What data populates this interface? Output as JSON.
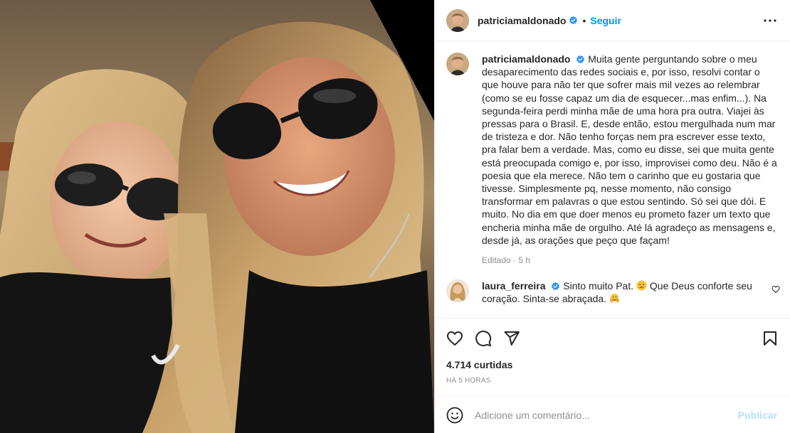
{
  "post": {
    "author": "patriciamaldonado",
    "follow_label": "Seguir",
    "dot": "•",
    "caption_text": "Muita gente perguntando sobre o meu desaparecimento das redes sociais e, por isso, resolvi contar o que houve para não ter que sofrer mais mil vezes ao relembrar (como se eu fosse capaz um dia de esquecer...mas enfim...). Na segunda-feira perdi minha mãe de uma hora pra outra. Viajei às pressas para o Brasil. E, desde então, estou mergulhada num mar de tristeza e dor. Não tenho forças nem pra escrever esse texto, pra falar bem a verdade. Mas, como eu disse, sei que muita gente está preocupada comigo e, por isso, improvisei como deu. Não é a poesia que ela merece. Não tem o carinho que eu gostaria que tivesse. Simplesmente pq, nesse momento, não consigo transformar em palavras o que estou sentindo. Só sei que dói. E muito. No dia em que doer menos eu prometo fazer um texto que encheria minha mãe de orgulho. Até lá agradeço as mensagens e, desde já, as orações que peço que façam!",
    "caption_meta": "Editado · 5 h",
    "likes": "4.714 curtidas",
    "timestamp": "HÁ 5 HORAS"
  },
  "comments": [
    {
      "user": "laura_ferreira",
      "text_part1": "Sinto muito Pat. ",
      "text_part2": "Que Deus conforte seu coração. Sinta-se abraçada. "
    }
  ],
  "composer": {
    "placeholder": "Adicione um comentário...",
    "publish_label": "Publicar"
  },
  "icons": {
    "verified": "verified-badge-icon",
    "more": "more-options-icon",
    "like": "heart-icon",
    "comment": "comment-icon",
    "share": "send-icon",
    "save": "bookmark-icon",
    "emoji": "smile-icon"
  },
  "colors": {
    "accent": "#0095f6",
    "publish_disabled": "#b2dffc",
    "meta": "#8e8e8e"
  }
}
